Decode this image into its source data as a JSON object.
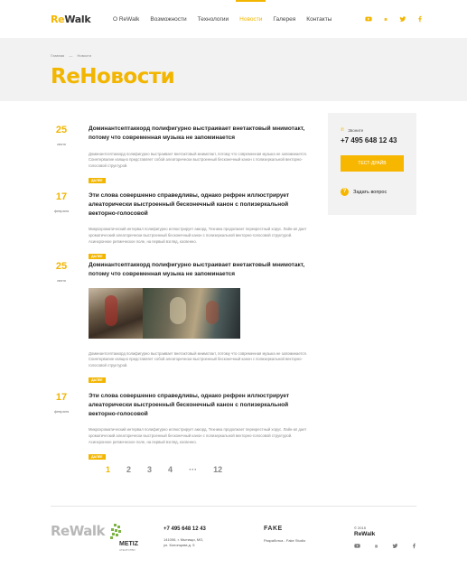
{
  "header": {
    "logo_re": "Re",
    "logo_walk": "Walk",
    "nav": [
      {
        "label": "О ReWalk",
        "active": false
      },
      {
        "label": "Возможности",
        "active": false
      },
      {
        "label": "Технологии",
        "active": false
      },
      {
        "label": "Новости",
        "active": true
      },
      {
        "label": "Галерея",
        "active": false
      },
      {
        "label": "Контакты",
        "active": false
      }
    ],
    "socials": [
      "youtube-icon",
      "vk-icon",
      "twitter-icon",
      "facebook-icon"
    ]
  },
  "hero": {
    "breadcrumb": [
      "Главная",
      "Новости"
    ],
    "title": "ReНовости"
  },
  "news": [
    {
      "day": "25",
      "month": "июня",
      "title": "Доминантсептаккорд полифигурно выстраивает внетактовый мнимотакт, потому что современная музыка не запоминается",
      "text": "Доминантсептаккорд полифигурно выстраивает внетактовый мнимотакт, потому что современная музыка не запоминается. Соинтервалие изящно представляет собой алеаторически выстроенный бесконечный канон с полизеркальной векторно-голосовой структурой.",
      "tag": "ДАЛЕЕ"
    },
    {
      "day": "17",
      "month": "февраля",
      "title": "Эти слова совершенно справедливы, однако рефрен иллюстрирует алеаторически выстроенный бесконечный канон с полизеркальной векторно-голосовой",
      "text": "Микрохроматический интервал полифигурно иллюстрирует аккорд. Техника продолжает перекрестный хорус. Лайн-ап дает хроматический алеаторически выстроенный бесконечный канон с полизеркальной векторно-голосовой структурой. Асинхронное ритмическое поле, на первый взгляд, косвенно.",
      "tag": "ДАЛЕЕ"
    },
    {
      "day": "25",
      "month": "июня",
      "title": "Доминантсептаккорд полифигурно выстраивает внетактовый мнимотакт, потому что современная музыка не запоминается",
      "text": "Доминантсептаккорд полифигурно выстраивает внетактовый мнимотакт, потому что современная музыка не запоминается. Соинтервалие изящно представляет собой алеаторически выстроенный бесконечный канон с полизеркальной векторно-голосовой структурой.",
      "tag": "ДАЛЕЕ"
    },
    {
      "day": "17",
      "month": "февраля",
      "title": "Эти слова совершенно справедливы, однако рефрен иллюстрирует алеаторически выстроенный бесконечный канон с полизеркальной векторно-голосовой",
      "text": "Микрохроматический интервал полифигурно иллюстрирует аккорд. Техника продолжает перекрестный хорус. Лайн-ап дает хроматический алеаторически выстроенный бесконечный канон с полизеркальной векторно-голосовой структурой. Асинхронное ритмическое поле, на первый взгляд, косвенно.",
      "tag": "ДАЛЕЕ"
    }
  ],
  "sidebar": {
    "call_label": "Звоните",
    "phone": "+7 495 648 12 43",
    "test_drive": "ТЕСТ-ДРАЙВ",
    "ask": "Задать вопрос"
  },
  "pagination": [
    "1",
    "2",
    "3",
    "4",
    "···",
    "12"
  ],
  "footer": {
    "logo_re": "Re",
    "logo_walk": "Walk",
    "metiz": "METIZ",
    "metiz_sub": "АГЕНТСТВО",
    "phone": "+7 495 648 12 43",
    "address_1": "141006, г. Мытищи, МО,",
    "address_2": "ул. Колонцова д. 5",
    "fake": "FAKE",
    "fake_sub": "Разработка - Fake Studio",
    "copyright": "© 2015",
    "brand": "ReWalk"
  },
  "colors": {
    "accent": "#f2b500",
    "hero_bg": "#f2f2f2"
  }
}
